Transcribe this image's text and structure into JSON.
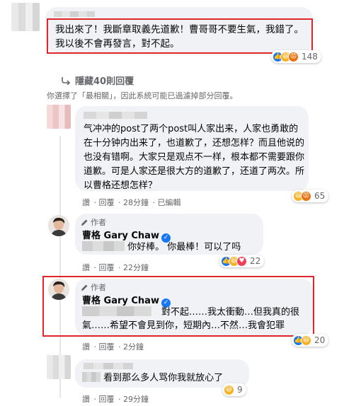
{
  "comment1": {
    "text": "我出來了！我斷章取義先道歉！曹哥哥不要生氣，我錯了。我以後不會再發言，對不起。",
    "reactions": {
      "icons": [
        "like-icon",
        "haha-icon",
        "angry-icon"
      ],
      "count": "148"
    }
  },
  "hidden_replies": {
    "label": "隱藏40則回覆",
    "notice": "你選擇了「最相關」，因此系統可能已過濾掉部分回覆。"
  },
  "reply1": {
    "text": "气冲冲的post了两个post叫人家出来，人家也勇敢的在十分钟内出来了，也道歉了，还想怎样？而且他说的也没有错啊。大家只是观点不一样，根本都不需要跟你道歉。可是人家还是很大方的道歉了，还道了两次。所以曹格还想怎样？",
    "actions": [
      "讚",
      "回覆",
      "28分鐘",
      "已編輯"
    ],
    "reactions": {
      "icons": [
        "haha-icon",
        "angry-icon"
      ],
      "count": "65"
    }
  },
  "reply2": {
    "author_tag": "作者",
    "author": "曹格 Gary Chaw",
    "text": "你好棒。 你最棒！可以了吗",
    "actions": [
      "讚",
      "回覆",
      "22分鐘"
    ],
    "reactions": {
      "icons": [
        "like-icon",
        "haha-icon",
        "love-icon"
      ],
      "count": "22"
    }
  },
  "reply3": {
    "author_tag": "作者",
    "author": "曹格 Gary Chaw",
    "text_line1": "對不起……我太衝動…但我真的很",
    "text_line2": "氣……希望不會見到你，短期內…不然…我會犯罪",
    "actions": [
      "讚",
      "回覆",
      "2分鐘"
    ],
    "reactions": {
      "icons": [
        "like-icon",
        "haha-icon"
      ],
      "count": "20"
    }
  },
  "reply4": {
    "text": "看到那么多人骂你我就放心了",
    "actions": [
      "讚",
      "回覆",
      "29分鐘"
    ],
    "reactions": {
      "icons": [
        "haha-icon"
      ],
      "count": "9"
    }
  },
  "colors": {
    "highlight": "#e0242c",
    "bubble": "#f0f2f5",
    "link": "#65676b",
    "like": "#1877f2"
  }
}
